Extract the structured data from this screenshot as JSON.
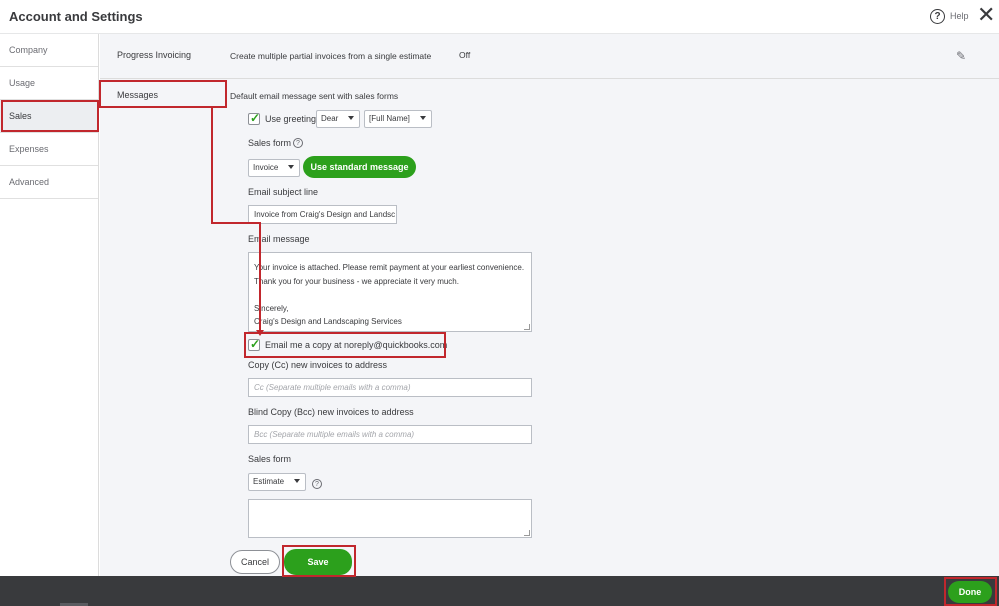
{
  "header": {
    "title": "Account and Settings",
    "help_label": "Help",
    "help_icon_glyph": "?",
    "close_glyph": "✕"
  },
  "sidebar": {
    "items": [
      {
        "label": "Company"
      },
      {
        "label": "Usage"
      },
      {
        "label": "Sales",
        "active": true
      },
      {
        "label": "Expenses"
      },
      {
        "label": "Advanced"
      }
    ]
  },
  "progress_invoicing": {
    "label": "Progress Invoicing",
    "description": "Create multiple partial invoices from a single estimate",
    "value": "Off",
    "edit_icon": "pencil-icon"
  },
  "messages": {
    "label": "Messages",
    "heading": "Default email message sent with sales forms",
    "use_greeting_label": "Use greeting",
    "use_greeting_checked": true,
    "greeting_select": "Dear",
    "name_select": "[Full Name]",
    "sales_form_label": "Sales form",
    "sales_form_select": "Invoice",
    "use_standard_button": "Use standard message",
    "subject_label": "Email subject line",
    "subject_value": "Invoice from Craig's Design and Landsc",
    "email_message_label": "Email message",
    "email_message_lines": [
      "Your invoice is attached.  Please remit payment at your earliest convenience.",
      "Thank you for your business - we appreciate it very much.",
      "",
      "Sincerely,",
      "Craig's Design and Landscaping Services"
    ],
    "email_copy_label": "Email me a copy at noreply@quickbooks.com",
    "email_copy_checked": true,
    "cc_label": "Copy (Cc) new invoices to address",
    "cc_placeholder": "Cc (Separate multiple emails with a comma)",
    "bcc_label": "Blind Copy (Bcc) new invoices to address",
    "bcc_placeholder": "Bcc (Separate multiple emails with a comma)",
    "sales_form2_label": "Sales form",
    "sales_form2_select": "Estimate",
    "cancel_button": "Cancel",
    "save_button": "Save"
  },
  "footer": {
    "done_button": "Done"
  },
  "colors": {
    "accent_green": "#2ca01c",
    "highlight_red": "#c1272d",
    "footer_bg": "#393a3d",
    "content_bg": "#f4f5f8"
  }
}
